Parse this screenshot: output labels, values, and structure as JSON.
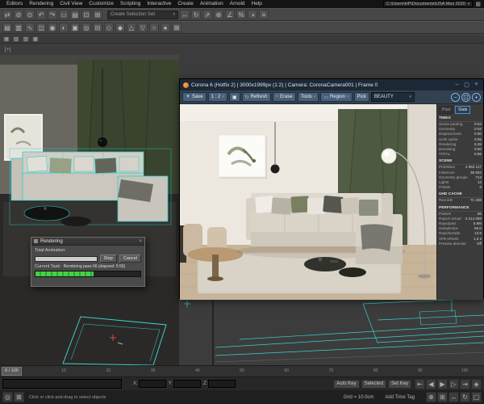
{
  "colors": {
    "accent_blue": "#4a90d9",
    "corona_orange": "#e8822e",
    "progress_green": "#38c13a",
    "selection_teal": "#2ad4d4"
  },
  "titlebar": {
    "project_path": "C:\\Users\\HP\\Documents\\USA Max 2020"
  },
  "menu": {
    "items": [
      "Editors",
      "Rendering",
      "Civil View",
      "Customize",
      "Scripting",
      "Interactive",
      "Create",
      "Animation",
      "Arnold",
      "Help"
    ]
  },
  "toolbar": {
    "selection_set_placeholder": "Create Selection Set",
    "row1_icons": [
      {
        "name": "select-and-link-icon",
        "glyph": "⇄"
      },
      {
        "name": "unlink-selection-icon",
        "glyph": "⊘"
      },
      {
        "name": "bind-to-space-warp-icon",
        "glyph": "⊙"
      },
      {
        "name": "undo-icon",
        "glyph": "↶"
      },
      {
        "name": "redo-icon",
        "glyph": "↷"
      },
      {
        "name": "select-object-icon",
        "glyph": "▭"
      },
      {
        "name": "select-by-name-icon",
        "glyph": "▤"
      },
      {
        "name": "selection-region-icon",
        "glyph": "⊡"
      },
      {
        "name": "window-crossing-icon",
        "glyph": "⊞"
      }
    ],
    "row1b_icons": [
      {
        "name": "select-and-move-icon",
        "glyph": "↔"
      },
      {
        "name": "select-and-rotate-icon",
        "glyph": "↻"
      },
      {
        "name": "select-and-scale-icon",
        "glyph": "⇗"
      },
      {
        "name": "snap-toggle-icon",
        "glyph": "⊕"
      },
      {
        "name": "angle-snap-icon",
        "glyph": "∠"
      },
      {
        "name": "percent-snap-icon",
        "glyph": "%"
      },
      {
        "name": "mirror-icon",
        "glyph": "◑"
      },
      {
        "name": "align-icon",
        "glyph": "≡"
      }
    ],
    "row2_icons": [
      {
        "name": "layer-manager-icon",
        "glyph": "▤"
      },
      {
        "name": "scene-explorer-icon",
        "glyph": "▥"
      },
      {
        "name": "curve-editor-icon",
        "glyph": "∿"
      },
      {
        "name": "schematic-view-icon",
        "glyph": "◫"
      },
      {
        "name": "material-editor-icon",
        "glyph": "◉"
      },
      {
        "name": "render-setup-icon",
        "glyph": "◐"
      },
      {
        "name": "rendered-frame-window-icon",
        "glyph": "▣"
      },
      {
        "name": "render-production-icon",
        "glyph": "◎"
      },
      {
        "name": "toolbar-icon",
        "glyph": "⊟"
      },
      {
        "name": "toolbar-icon",
        "glyph": "◇"
      },
      {
        "name": "toolbar-icon",
        "glyph": "◆"
      },
      {
        "name": "toolbar-icon",
        "glyph": "△"
      },
      {
        "name": "toolbar-icon",
        "glyph": "▽"
      },
      {
        "name": "toolbar-icon",
        "glyph": "○"
      },
      {
        "name": "toolbar-icon",
        "glyph": "●"
      },
      {
        "name": "toolbar-icon",
        "glyph": "⊠"
      }
    ],
    "ribbon_icons": [
      {
        "name": "ribbon-modeling-icon",
        "glyph": "▦"
      },
      {
        "name": "ribbon-freeform-icon",
        "glyph": "▧"
      },
      {
        "name": "ribbon-selection-icon",
        "glyph": "▨"
      },
      {
        "name": "ribbon-object-paint-icon",
        "glyph": "▩"
      }
    ]
  },
  "viewport": {
    "label": "[+]"
  },
  "vfb": {
    "title": "Corona 6 (Hotfix 2) | 3000x1999px (1:2) | Camera: CoronaCamera001 | Frame 0",
    "window_buttons": [
      {
        "name": "vfb-minimize-button",
        "glyph": "–"
      },
      {
        "name": "vfb-maximize-button",
        "glyph": "▢"
      },
      {
        "name": "vfb-close-button",
        "glyph": "×"
      }
    ],
    "toolbar": {
      "save": "Save",
      "scale": "1 : 2",
      "copy_glyph": "▣",
      "refresh": "Refresh",
      "erase": "Erase",
      "tools": "Tools",
      "region": "Region",
      "pick": "Pick",
      "element": "BEAUTY",
      "zoom_icons": [
        {
          "name": "vfb-zoom-out-icon",
          "glyph": "−"
        },
        {
          "name": "vfb-zoom-reset-icon",
          "glyph": "⊡"
        },
        {
          "name": "vfb-zoom-in-icon",
          "glyph": "+"
        }
      ]
    },
    "panel": {
      "tabs": [
        "Post",
        "Stats"
      ],
      "active_tab": 1,
      "sections": [
        {
          "title": "TIMES",
          "rows": [
            {
              "label": "Scene parsing",
              "value": "0:04"
            },
            {
              "label": "Geometry",
              "value": "0:02"
            },
            {
              "label": "Displacement",
              "value": "0:00"
            },
            {
              "label": "UHD cache",
              "value": "0:05"
            },
            {
              "label": "Rendering",
              "value": "5:45"
            },
            {
              "label": "Denoising",
              "value": "0:00"
            },
            {
              "label": "TOTAL",
              "value": "5:56"
            }
          ]
        },
        {
          "title": "SCENE",
          "rows": [
            {
              "label": "Primitives",
              "value": "4 982 117"
            },
            {
              "label": "Instances",
              "value": "36 504"
            },
            {
              "label": "Geometry groups",
              "value": "712"
            },
            {
              "label": "Lights",
              "value": "13"
            },
            {
              "label": "Portals",
              "value": "0"
            }
          ]
        },
        {
          "title": "UHD CACHE",
          "rows": [
            {
              "label": "Records",
              "value": "71 338"
            }
          ]
        },
        {
          "title": "PERFORMANCE",
          "rows": [
            {
              "label": "Passes",
              "value": "66"
            },
            {
              "label": "Rays/s actual",
              "value": "3 214 000"
            },
            {
              "label": "Rays/pass",
              "value": "5.9M"
            },
            {
              "label": "Samples/px",
              "value": "66.0"
            },
            {
              "label": "Rays/sample",
              "value": "13.8"
            },
            {
              "label": "VFB refresh",
              "value": "1.0 s"
            },
            {
              "label": "Preview denoise",
              "value": "Off"
            }
          ]
        }
      ]
    }
  },
  "progress": {
    "title": "Rendering",
    "total_label": "Total Animation:",
    "stop": "Stop",
    "cancel": "Cancel",
    "task_label": "Current Task:",
    "task_value": "Rendering pass 66 (elapsed: 5:56)",
    "total_pct": 0,
    "task_pct": 55
  },
  "timeline": {
    "ticks": [
      "0",
      "10",
      "20",
      "30",
      "40",
      "50",
      "60",
      "70",
      "80",
      "90",
      "100"
    ],
    "handle_label": "0 / 100"
  },
  "statusbar": {
    "prompt": "Click or click-and-drag to select objects",
    "grid": "Grid = 10.0cm",
    "add_time_tag": "Add Time Tag",
    "auto_key": "Auto Key",
    "set_key": "Set Key",
    "key_filter": "Selected",
    "coords": [
      {
        "label": "X:",
        "value": ""
      },
      {
        "label": "Y:",
        "value": ""
      },
      {
        "label": "Z:",
        "value": ""
      }
    ],
    "left_icons": [
      {
        "name": "isolate-selection-icon",
        "glyph": "◎"
      },
      {
        "name": "selection-lock-icon",
        "glyph": "⊠"
      }
    ],
    "time_icons": [
      {
        "name": "go-to-start-icon",
        "glyph": "⇤"
      },
      {
        "name": "previous-frame-icon",
        "glyph": "◀"
      },
      {
        "name": "play-icon",
        "glyph": "▶"
      },
      {
        "name": "next-frame-icon",
        "glyph": "▷"
      },
      {
        "name": "go-to-end-icon",
        "glyph": "⇥"
      },
      {
        "name": "key-mode-icon",
        "glyph": "◈"
      }
    ],
    "nav_icons": [
      {
        "name": "zoom-icon",
        "glyph": "⊕"
      },
      {
        "name": "zoom-extents-icon",
        "glyph": "⊞"
      },
      {
        "name": "pan-icon",
        "glyph": "↔"
      },
      {
        "name": "orbit-icon",
        "glyph": "↻"
      },
      {
        "name": "maximize-viewport-icon",
        "glyph": "▢"
      }
    ]
  }
}
